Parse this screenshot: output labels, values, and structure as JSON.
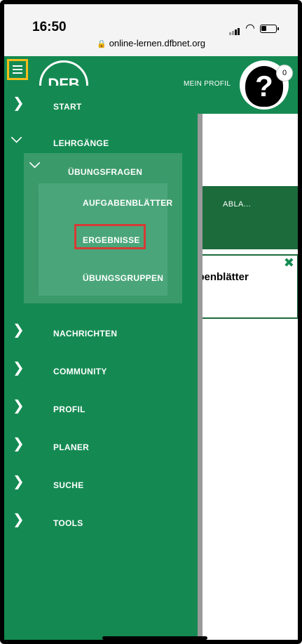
{
  "status_bar": {
    "time": "16:50"
  },
  "url_bar": {
    "url": "online-lernen.dfbnet.org"
  },
  "header": {
    "profile_link": "MEIN PROFIL",
    "notification_count": "0"
  },
  "content": {
    "tab_partial": "ABLA...",
    "card_title": "abenblätter",
    "card_close": "✖"
  },
  "nav": {
    "items": [
      {
        "label": "START",
        "expanded": false
      },
      {
        "label": "LEHRGÄNGE",
        "expanded": true
      },
      {
        "label": "NACHRICHTEN",
        "expanded": false
      },
      {
        "label": "COMMUNITY",
        "expanded": false
      },
      {
        "label": "PROFIL",
        "expanded": false
      },
      {
        "label": "PLANER",
        "expanded": false
      },
      {
        "label": "SUCHE",
        "expanded": false
      },
      {
        "label": "TOOLS",
        "expanded": false
      }
    ],
    "submenu": {
      "label": "ÜBUNGSFRAGEN",
      "items": [
        {
          "label": "AUFGABENBLÄTTER"
        },
        {
          "label": "ERGEBNISSE",
          "highlighted": true
        },
        {
          "label": "ÜBUNGSGRUPPEN"
        }
      ]
    }
  },
  "colors": {
    "brand_green": "#148a52",
    "dark_green": "#1b6b3b",
    "highlight_red": "#d63a35",
    "hamburger_highlight": "#f5bd19"
  }
}
